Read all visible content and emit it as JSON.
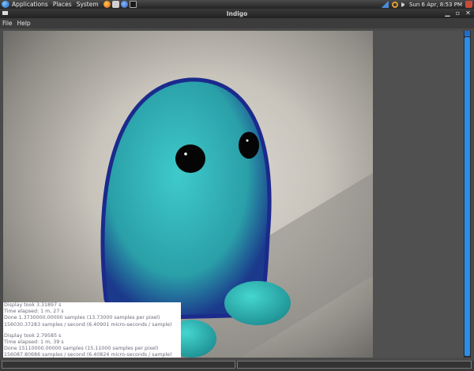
{
  "panel": {
    "menus": [
      "Applications",
      "Places",
      "System"
    ],
    "clock": "Sun  6 Apr,  8:53 PM"
  },
  "window": {
    "title": "Indigo",
    "menu": [
      "File",
      "Help"
    ]
  },
  "log": {
    "lines": [
      "Display took 3.31897 s",
      "Time elapsed: 1 m, 27 s",
      "Done 1.3730000.00000 samples (13.73000 samples per pixel)",
      "156030.37283 samples / second (6.40901 micro-seconds / sample)",
      "",
      "Display took 2.79585 s",
      "Time elapsed: 1 m, 39 s",
      "Done 15110000.00000 samples (15.11000 samples per pixel)",
      "156087.80686 samples / second (6.40824 micro-seconds / sample)"
    ]
  },
  "colors": {
    "accent": "#2a8fe8",
    "creature": "#2fb7b7",
    "fur_dark": "#1a2a8a"
  }
}
